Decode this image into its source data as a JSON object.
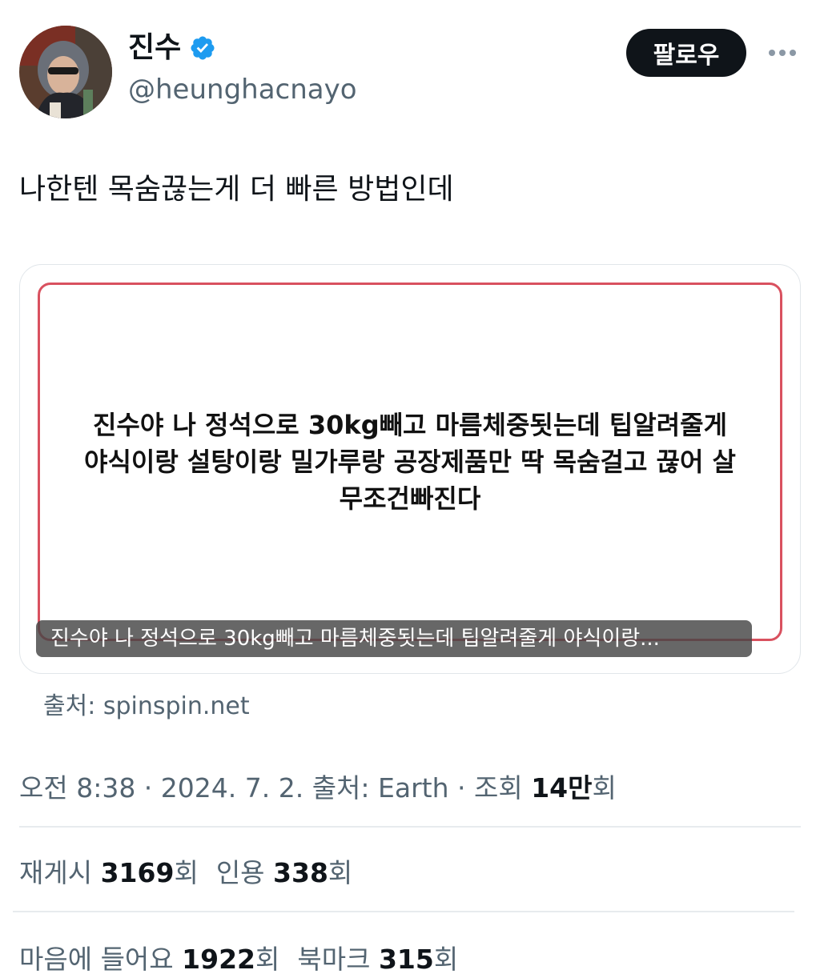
{
  "author": {
    "display_name": "진수",
    "handle": "@heunghacnayo",
    "avatar_icon": "profile-photo",
    "verified_icon": "verified-badge-icon"
  },
  "actions": {
    "follow_label": "팔로우",
    "more_icon": "more-icon"
  },
  "tweet": {
    "text": "나한텐 목숨끊는게 더 빠른 방법인데"
  },
  "card": {
    "image_text_line1": "진수야 나 정석으로 30kg빼고 마름체중됫는데 팁알려줄게",
    "image_text_line2": "야식이랑 설탕이랑 밀가루랑 공장제품만 딱 목숨걸고 끊어 살",
    "image_text_line3": "무조건빠진다",
    "caption": "진수야 나 정석으로 30kg빼고 마름체중됫는데 팁알려줄게 야식이랑...",
    "source": "출처: spinspin.net"
  },
  "meta": {
    "time_date": "오전 8:38 · 2024. 7. 2. 출처: Earth · 조회 ",
    "views_number": "14만",
    "views_suffix": "회"
  },
  "stats": {
    "reposts_label": "재게시 ",
    "reposts_value": "3169",
    "reposts_suffix": "회",
    "quotes_label": "인용 ",
    "quotes_value": "338",
    "quotes_suffix": "회",
    "likes_label": "마음에 들어요 ",
    "likes_value": "1922",
    "likes_suffix": "회",
    "bookmarks_label": "북마크 ",
    "bookmarks_value": "315",
    "bookmarks_suffix": "회"
  },
  "colors": {
    "text_primary": "#0f1419",
    "text_secondary": "#536471",
    "verified_blue": "#1d9bf0",
    "card_border_red": "#d9515f"
  }
}
